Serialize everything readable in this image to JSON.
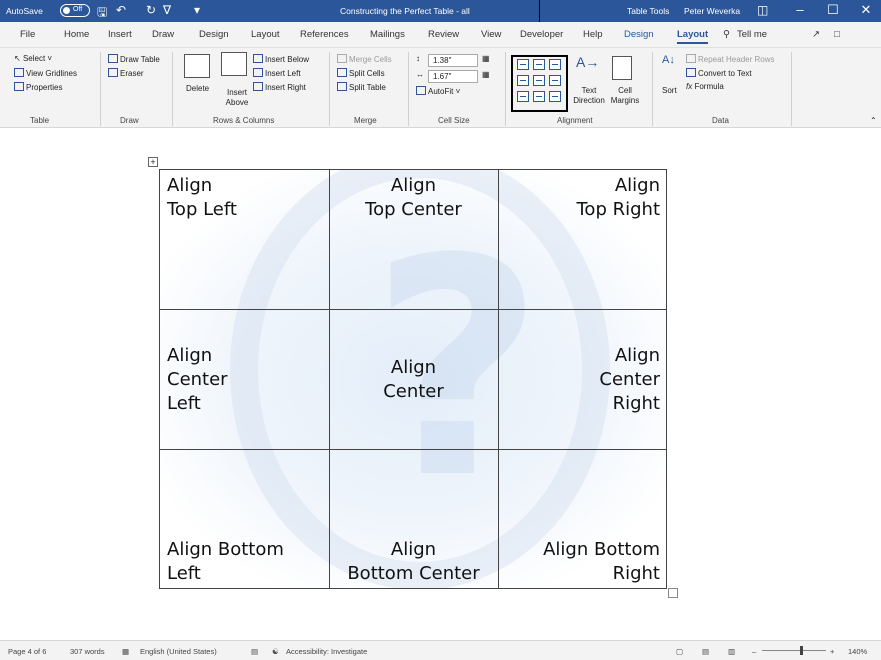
{
  "titlebar": {
    "autosave": "AutoSave",
    "autosave_state": "Off",
    "doc_title": "Constructing the Perfect Table - all",
    "context": "Table Tools",
    "user": "Peter Weverka"
  },
  "tabs": [
    "File",
    "Home",
    "Insert",
    "Draw",
    "Design",
    "Layout",
    "References",
    "Mailings",
    "Review",
    "View",
    "Developer",
    "Help",
    "Design",
    "Layout",
    "Tell me"
  ],
  "ribbon": {
    "table": {
      "select": "Select",
      "gridlines": "View Gridlines",
      "properties": "Properties",
      "group": "Table"
    },
    "draw": {
      "draw_table": "Draw Table",
      "eraser": "Eraser",
      "group": "Draw"
    },
    "rows_cols": {
      "delete": "Delete",
      "insert_above": "Insert Above",
      "insert_below": "Insert Below",
      "insert_left": "Insert Left",
      "insert_right": "Insert Right",
      "group": "Rows & Columns"
    },
    "merge": {
      "merge_cells": "Merge Cells",
      "split_cells": "Split Cells",
      "split_table": "Split Table",
      "group": "Merge"
    },
    "cell_size": {
      "height": "1.38\"",
      "width": "1.67\"",
      "autofit": "AutoFit",
      "group": "Cell Size"
    },
    "alignment": {
      "text_direction": "Text Direction",
      "cell_margins": "Cell Margins",
      "group": "Alignment"
    },
    "data": {
      "sort": "Sort",
      "repeat_header": "Repeat Header Rows",
      "convert": "Convert to Text",
      "formula": "Formula",
      "group": "Data"
    }
  },
  "table": {
    "cells": [
      [
        "Align\nTop Left",
        "Align\nTop Center",
        "Align\nTop Right"
      ],
      [
        "Align\nCenter\nLeft",
        "Align\nCenter",
        "Align\nCenter\nRight"
      ],
      [
        "Align Bottom\nLeft",
        "Align\nBottom Center",
        "Align Bottom\nRight"
      ]
    ]
  },
  "status": {
    "page": "Page 4 of 6",
    "words": "307 words",
    "language": "English (United States)",
    "accessibility": "Accessibility: Investigate",
    "zoom": "140%"
  }
}
